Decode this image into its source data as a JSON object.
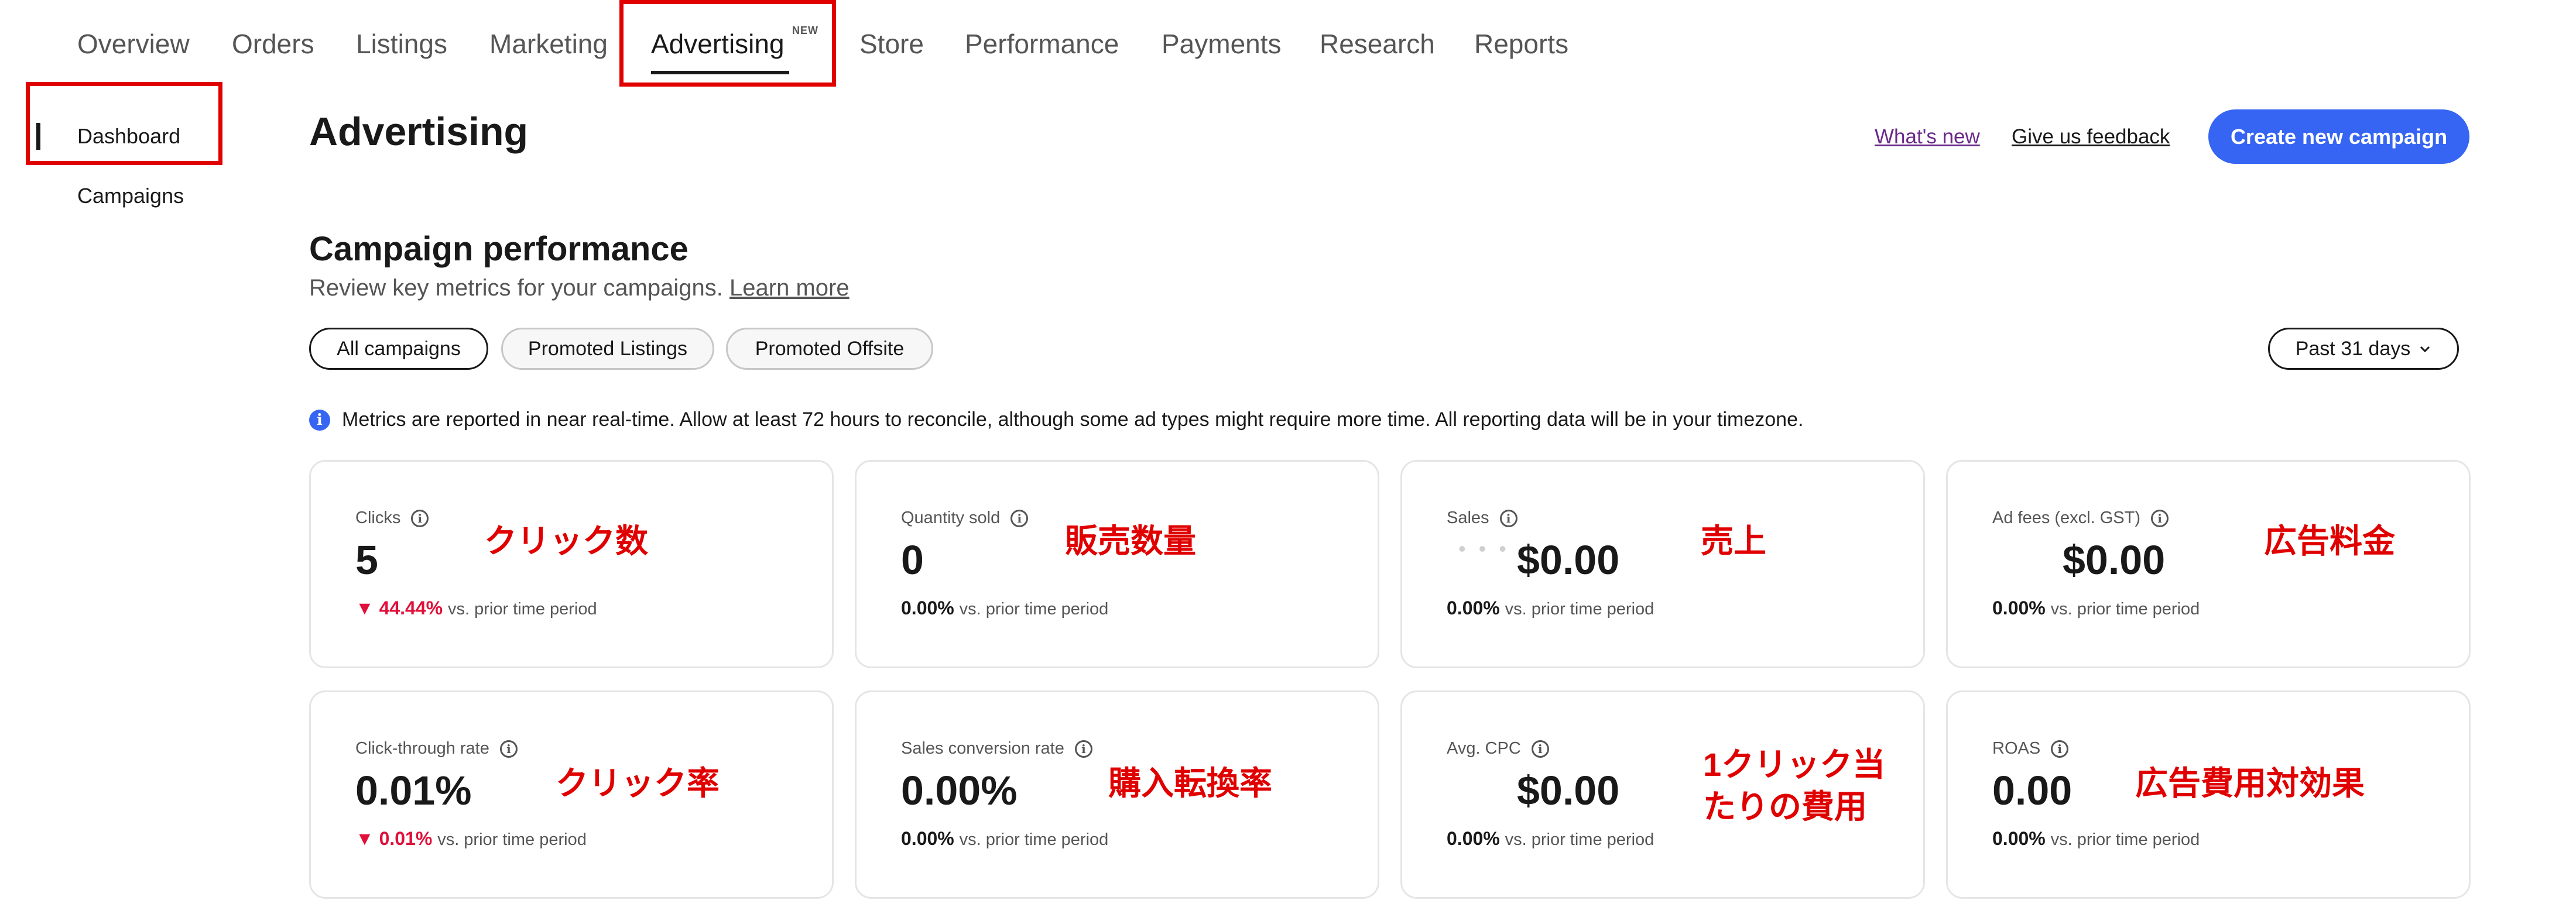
{
  "nav": {
    "items": [
      "Overview",
      "Orders",
      "Listings",
      "Marketing",
      "Advertising",
      "Store",
      "Performance",
      "Payments",
      "Research",
      "Reports"
    ],
    "active": "Advertising",
    "new_badge": "NEW"
  },
  "sidebar": {
    "items": [
      "Dashboard",
      "Campaigns"
    ],
    "active": "Dashboard"
  },
  "header": {
    "title": "Advertising",
    "whats_new": "What's new",
    "feedback": "Give us feedback",
    "create_button": "Create new campaign"
  },
  "performance": {
    "title": "Campaign performance",
    "subtitle": "Review key metrics for your campaigns.",
    "learn_more": "Learn more",
    "filters": [
      "All campaigns",
      "Promoted Listings",
      "Promoted Offsite"
    ],
    "date_range": "Past 31 days",
    "info": "Metrics are reported in near real-time. Allow at least 72 hours to reconcile, although some ad types might require more time. All reporting data will be in your timezone."
  },
  "metrics": [
    {
      "label": "Clicks",
      "value": "5",
      "change": "44.44%",
      "change_dir": "down",
      "compare": "vs. prior time period",
      "annotation": "クリック数"
    },
    {
      "label": "Quantity sold",
      "value": "0",
      "change": "0.00%",
      "change_dir": "flat",
      "compare": "vs. prior time period",
      "annotation": "販売数量"
    },
    {
      "label": "Sales",
      "value": "$0.00",
      "change": "0.00%",
      "change_dir": "flat",
      "compare": "vs. prior time period",
      "annotation": "売上"
    },
    {
      "label": "Ad fees (excl. GST)",
      "value": "$0.00",
      "change": "0.00%",
      "change_dir": "flat",
      "compare": "vs. prior time period",
      "annotation": "広告料金"
    },
    {
      "label": "Click-through rate",
      "value": "0.01%",
      "change": "0.01%",
      "change_dir": "down",
      "compare": "vs. prior time period",
      "annotation": "クリック率"
    },
    {
      "label": "Sales conversion rate",
      "value": "0.00%",
      "change": "0.00%",
      "change_dir": "flat",
      "compare": "vs. prior time period",
      "annotation": "購入転換率"
    },
    {
      "label": "Avg. CPC",
      "value": "$0.00",
      "change": "0.00%",
      "change_dir": "flat",
      "compare": "vs. prior time period",
      "annotation_line1": "1クリック当",
      "annotation_line2": "たりの費用"
    },
    {
      "label": "ROAS",
      "value": "0.00",
      "change": "0.00%",
      "change_dir": "flat",
      "compare": "vs. prior time period",
      "annotation": "広告費用対効果"
    }
  ],
  "colors": {
    "accent": "#3665f3",
    "negative": "#e0103a",
    "annotation": "#e00000"
  },
  "icons": {
    "info": "info-icon",
    "chevron": "chevron-down-icon",
    "trend_down": "triangle-down-icon"
  }
}
